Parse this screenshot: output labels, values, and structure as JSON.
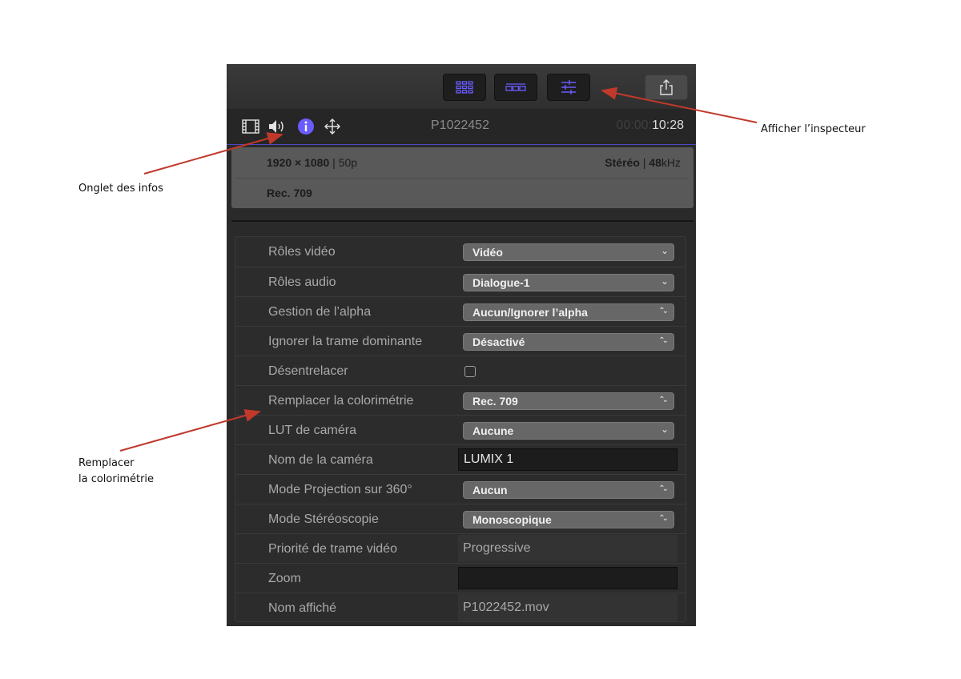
{
  "annotations": {
    "inspector": "Afficher l’inspecteur",
    "info_tab": "Onglet des infos",
    "colorimetry_line1": "Remplacer",
    "colorimetry_line2": "la colorimétrie"
  },
  "colors": {
    "arrow": "#c0392b",
    "accent": "#6a5cff",
    "panel": "#2a2a2a"
  },
  "toolbar": {
    "buttons": [
      {
        "icon": "browser-grid-icon"
      },
      {
        "icon": "timeline-icon"
      },
      {
        "icon": "inspector-sliders-icon"
      },
      {
        "icon": "share-icon"
      }
    ]
  },
  "tabbar": {
    "tabs": [
      "video-tab-icon",
      "audio-tab-icon",
      "info-tab-icon",
      "transform-tab-icon"
    ],
    "clip_name": "P1022452",
    "timecode_dim": "00:00:",
    "timecode_bright": "10:28"
  },
  "info": {
    "resolution": "1920 × 1080",
    "framerate": "| 50p",
    "audio": "Stéréo",
    "sample_rate_value": "48",
    "sample_rate_unit": "kHz",
    "color_space": "Rec. 709"
  },
  "properties": [
    {
      "label": "Rôles vidéo",
      "type": "popup",
      "value": "Vidéo",
      "arrow": "⌄"
    },
    {
      "label": "Rôles audio",
      "type": "popup",
      "value": "Dialogue-1",
      "arrow": "⌄"
    },
    {
      "label": "Gestion de l’alpha",
      "type": "popup",
      "value": "Aucun/Ignorer l’alpha",
      "arrow": "⌃⌄"
    },
    {
      "label": "Ignorer la trame dominante",
      "type": "popup",
      "value": "Désactivé",
      "arrow": "⌃⌄"
    },
    {
      "label": "Désentrelacer",
      "type": "checkbox",
      "checked": false
    },
    {
      "label": "Remplacer la colorimétrie",
      "type": "popup",
      "value": "Rec. 709",
      "arrow": "⌃⌄"
    },
    {
      "label": "LUT de caméra",
      "type": "popup",
      "value": "Aucune",
      "arrow": "⌄"
    },
    {
      "label": "Nom de la caméra",
      "type": "field",
      "value": "LUMIX 1"
    },
    {
      "label": "Mode Projection sur 360°",
      "type": "popup",
      "value": "Aucun",
      "arrow": "⌃⌄"
    },
    {
      "label": "Mode Stéréoscopie",
      "type": "popup",
      "value": "Monoscopique",
      "arrow": "⌃⌄"
    },
    {
      "label": "Priorité de trame vidéo",
      "type": "static",
      "value": "Progressive"
    },
    {
      "label": "Zoom",
      "type": "field",
      "value": ""
    },
    {
      "label": "Nom affiché",
      "type": "static",
      "value": "P1022452.mov"
    }
  ]
}
